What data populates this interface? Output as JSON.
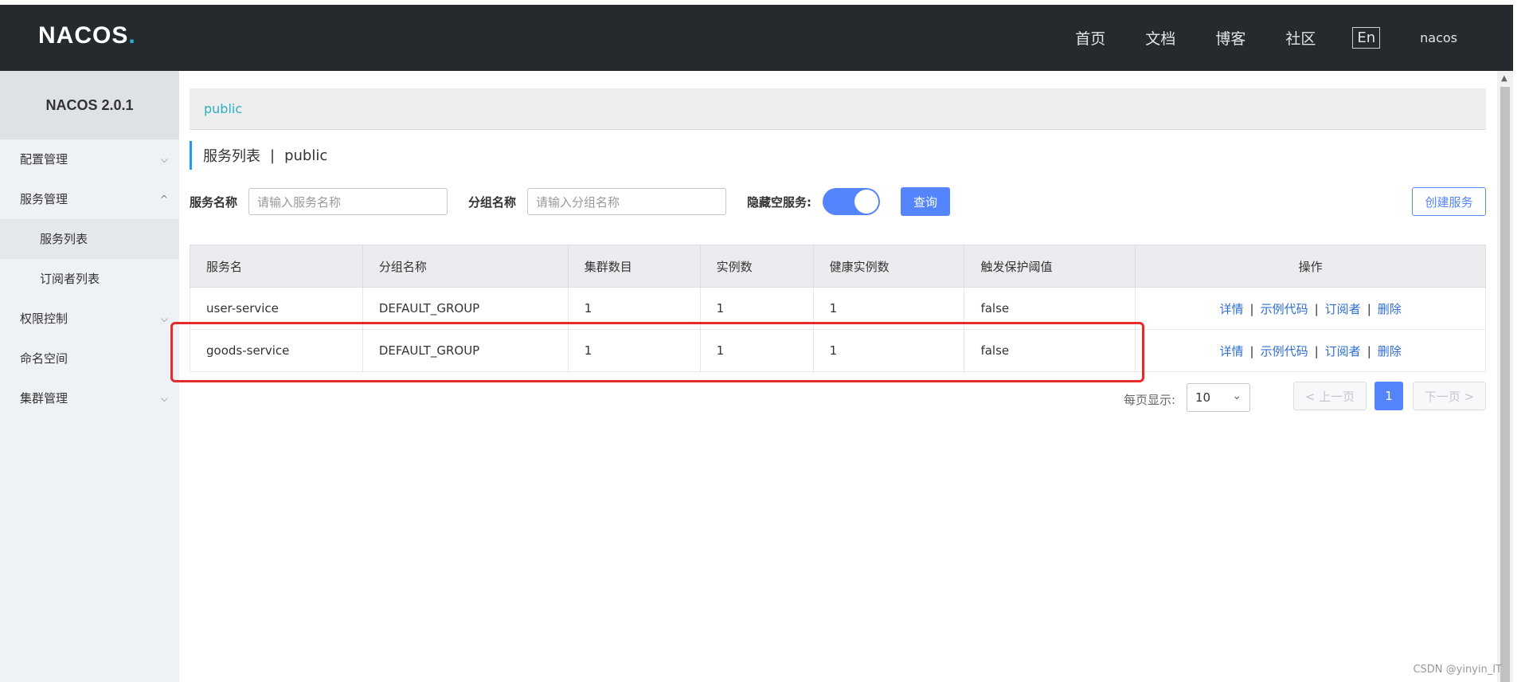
{
  "header": {
    "logo": "NACOS",
    "logo_dot": ".",
    "nav": [
      "首页",
      "文档",
      "博客",
      "社区"
    ],
    "lang": "En",
    "user": "nacos"
  },
  "sidebar": {
    "title": "NACOS 2.0.1",
    "items": [
      {
        "label": "配置管理",
        "chevron": "⌵"
      },
      {
        "label": "服务管理",
        "chevron": "^"
      },
      {
        "label": "服务列表"
      },
      {
        "label": "订阅者列表"
      },
      {
        "label": "权限控制",
        "chevron": "⌵"
      },
      {
        "label": "命名空间"
      },
      {
        "label": "集群管理",
        "chevron": "⌵"
      }
    ]
  },
  "main": {
    "namespace": "public",
    "title": "服务列表",
    "title_sep": "|",
    "title_ns": "public",
    "filters": {
      "service_label": "服务名称",
      "service_placeholder": "请输入服务名称",
      "group_label": "分组名称",
      "group_placeholder": "请输入分组名称",
      "hide_empty_label": "隐藏空服务:",
      "query_button": "查询",
      "create_button": "创建服务"
    },
    "table": {
      "headers": [
        "服务名",
        "分组名称",
        "集群数目",
        "实例数",
        "健康实例数",
        "触发保护阈值",
        "操作"
      ],
      "rows": [
        [
          "user-service",
          "DEFAULT_GROUP",
          "1",
          "1",
          "1",
          "false"
        ],
        [
          "goods-service",
          "DEFAULT_GROUP",
          "1",
          "1",
          "1",
          "false"
        ]
      ],
      "ops": [
        "详情",
        "示例代码",
        "订阅者",
        "删除"
      ],
      "op_sep": "|"
    },
    "pager": {
      "label": "每页显示:",
      "page_size": "10",
      "prev": "< 上一页",
      "current": "1",
      "next": "下一页 >"
    }
  },
  "watermark": "CSDN @yinyin_IT",
  "colors": {
    "header_bg": "#252a2f",
    "primary": "#5584ff",
    "link": "#2f6fd3",
    "highlight": "#e52b2b"
  }
}
